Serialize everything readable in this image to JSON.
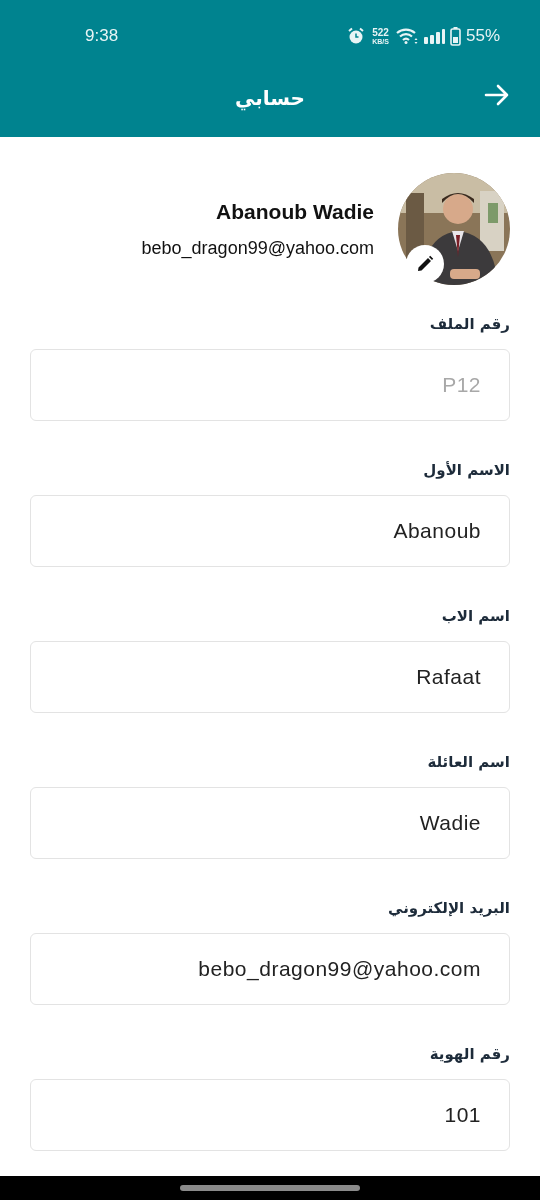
{
  "status_bar": {
    "time": "9:38",
    "speed_value": "522",
    "speed_unit": "KB/S",
    "battery": "55%"
  },
  "app_bar": {
    "title": "حسابي"
  },
  "profile": {
    "name": "Abanoub Wadie",
    "email": "bebo_dragon99@yahoo.com"
  },
  "fields": [
    {
      "label": "رقم الملف",
      "placeholder": "P12"
    },
    {
      "label": "الاسم الأول",
      "value": "Abanoub"
    },
    {
      "label": "اسم الاب",
      "value": "Rafaat"
    },
    {
      "label": "اسم العائلة",
      "value": "Wadie"
    },
    {
      "label": "البريد الإلكتروني",
      "value": "bebo_dragon99@yahoo.com"
    },
    {
      "label": "رقم الهوية",
      "value": "101"
    }
  ]
}
